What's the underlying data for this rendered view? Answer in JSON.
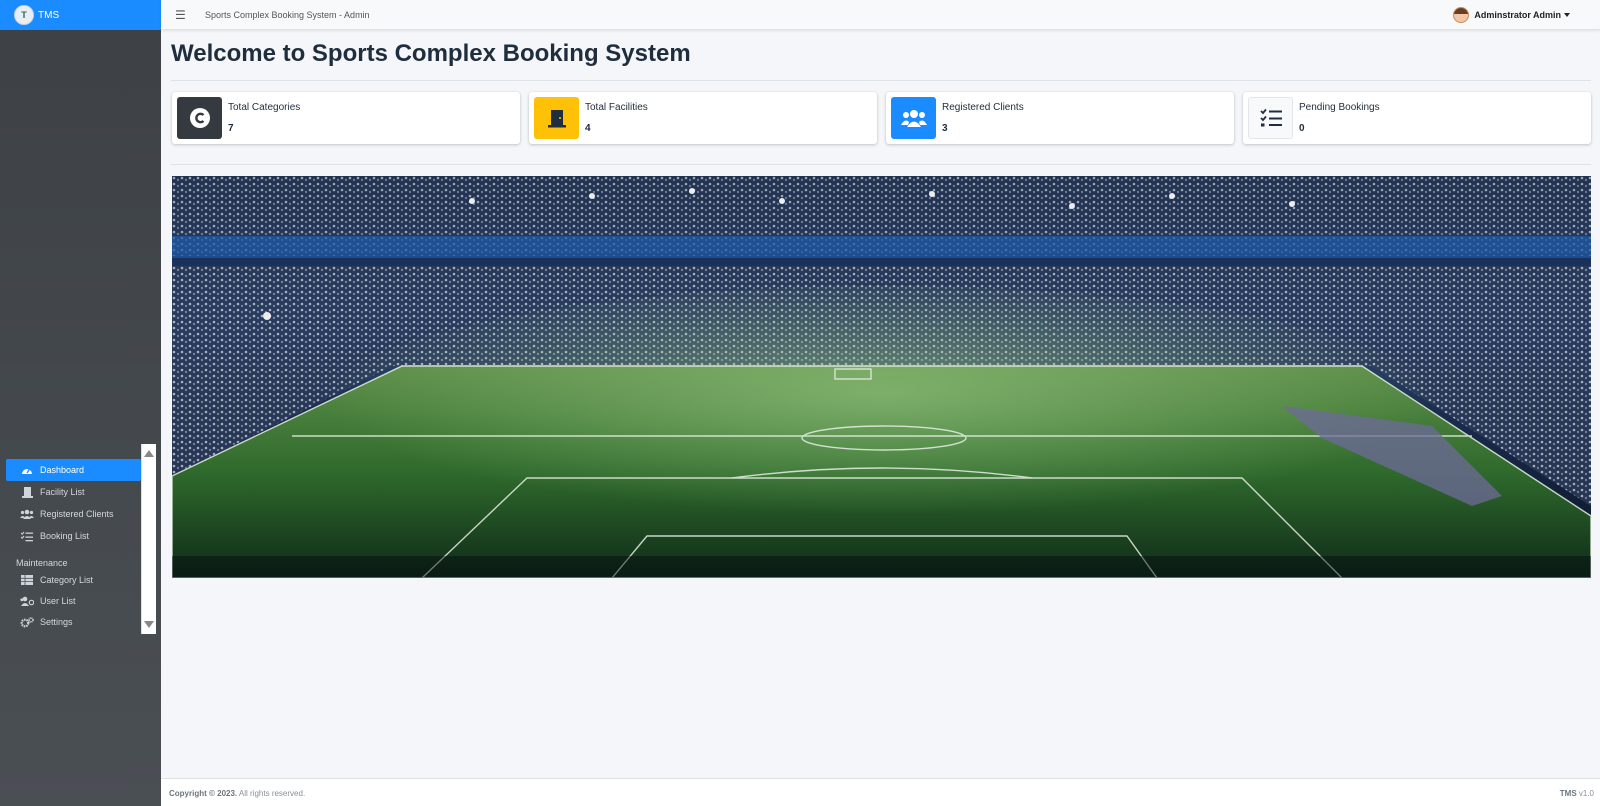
{
  "brand": {
    "name": "TMS",
    "logo_text": "T"
  },
  "topbar": {
    "title": "Sports Complex Booking System - Admin",
    "user_name": "Adminstrator Admin"
  },
  "sidebar": {
    "items": [
      {
        "label": "Dashboard",
        "icon": "dashboard-icon",
        "active": true
      },
      {
        "label": "Facility List",
        "icon": "door-icon"
      },
      {
        "label": "Registered Clients",
        "icon": "users-icon"
      },
      {
        "label": "Booking List",
        "icon": "list-check-icon"
      }
    ],
    "maintenance_header": "Maintenance",
    "maintenance_items": [
      {
        "label": "Category List",
        "icon": "table-icon"
      },
      {
        "label": "User List",
        "icon": "users-cog-icon"
      },
      {
        "label": "Settings",
        "icon": "cogs-icon"
      }
    ]
  },
  "main": {
    "title": "Welcome to Sports Complex Booking System",
    "cards": [
      {
        "label": "Total Categories",
        "value": "7",
        "icon": "copyright-icon",
        "color": "#343a40"
      },
      {
        "label": "Total Facilities",
        "value": "4",
        "icon": "door-closed-icon",
        "color": "#ffc107"
      },
      {
        "label": "Registered Clients",
        "value": "3",
        "icon": "users-icon",
        "color": "#007bff"
      },
      {
        "label": "Pending Bookings",
        "value": "0",
        "icon": "tasks-icon",
        "color": "#f8f9fa"
      }
    ]
  },
  "footer": {
    "copyright_bold": "Copyright © 2023.",
    "copyright_rest": " All rights reserved.",
    "app_name": "TMS",
    "version": " v1.0"
  }
}
